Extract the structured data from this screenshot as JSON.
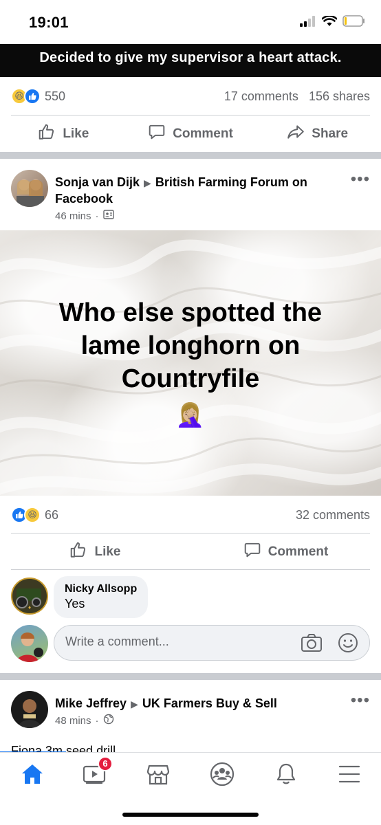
{
  "status_bar": {
    "time": "19:01"
  },
  "video_post": {
    "caption": "Decided to give my supervisor a heart attack.",
    "reaction_count": "550",
    "comments": "17 comments",
    "shares": "156 shares",
    "actions": {
      "like": "Like",
      "comment": "Comment",
      "share": "Share"
    }
  },
  "post2": {
    "author": "Sonja van Dijk",
    "group": "British Farming Forum on Facebook",
    "time": "46 mins",
    "image_text": "Who else spotted the lame longhorn on Countryfile",
    "image_emoji": "🤦🏼‍♀️",
    "reaction_count": "66",
    "comments": "32 comments",
    "actions": {
      "like": "Like",
      "comment": "Comment"
    },
    "top_comment": {
      "author": "Nicky Allsopp",
      "text": "Yes"
    },
    "write_placeholder": "Write a comment..."
  },
  "post3": {
    "author": "Mike Jeffrey",
    "group": "UK Farmers Buy & Sell",
    "time": "48 mins",
    "text_partial": "Fiona 3m seed drill"
  },
  "tabbar": {
    "watch_badge": "6"
  },
  "colors": {
    "accent": "#1877f2",
    "badge": "#e41e3f",
    "separator": "#c9ccd1"
  }
}
